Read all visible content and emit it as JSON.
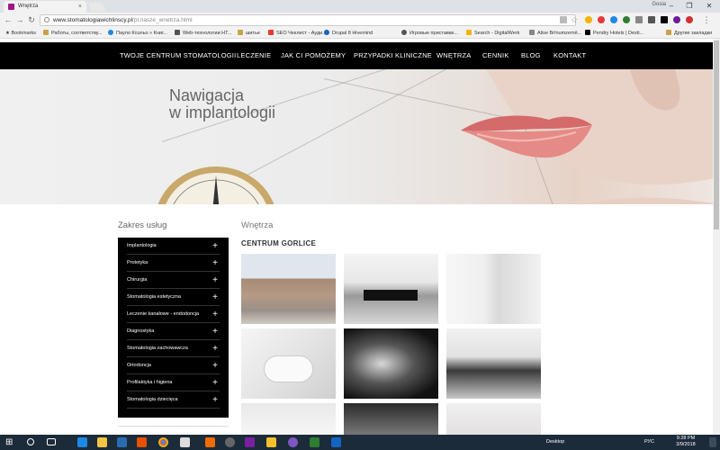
{
  "browser": {
    "tab_title": "Wnętrza",
    "tab_close": "×",
    "user_label": "Gosia",
    "url_host": "www.stomatologiawichlinscy.pl",
    "url_path": "/pl,nasze_wnetrza.html",
    "bookmarks_label": "Bookmarks",
    "bookmarks": [
      "Работы, соответству...",
      "Пауло Коэльо » Книг...",
      "Web-технологии HT...",
      "шитье",
      "SEO Чеклист - Ауди...",
      "Drupal 8 Hivemind",
      "Игровые приставки...",
      "Search - DigitalWerk",
      "Alise Brīnumzemē...",
      "Pendry Hotels | Desti..."
    ],
    "other_bookmarks": "Другие закладки"
  },
  "nav": {
    "items": [
      "TWOJE CENTRUM STOMATOLOGII",
      "LECZENIE",
      "JAK CI POMOŻEMY",
      "PRZYPADKI KLINICZNE",
      "WNĘTRZA",
      "CENNIK",
      "BLOG",
      "KONTAKT"
    ]
  },
  "hero": {
    "line1": "Nawigacja",
    "line2": "w implantologii"
  },
  "sidebar": {
    "title": "Zakres usług",
    "items": [
      "Implantologia",
      "Protetyka",
      "Chirurgia",
      "Stomatologia estetyczna",
      "Leczenie kanałowe - endodoncja",
      "Diagnostyka",
      "Stomatologia zachowawcza",
      "Ortodoncja",
      "Profilaktyka i higiena",
      "Stomatologia dziecięca"
    ],
    "expand_symbol": "+"
  },
  "main": {
    "section_title": "Wnętrza",
    "center_title": "CENTRUM GORLICE"
  },
  "taskbar": {
    "desktop_label": "Desktop",
    "lang": "РУС",
    "time": "9:28 PM",
    "date": "3/9/2018"
  }
}
